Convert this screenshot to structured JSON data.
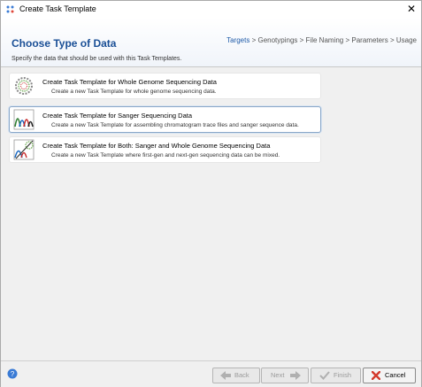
{
  "window": {
    "title": "Create Task Template"
  },
  "breadcrumb": {
    "steps": [
      "Targets",
      "Genotypings",
      "File Naming",
      "Parameters",
      "Usage"
    ],
    "separator": ">"
  },
  "header": {
    "title": "Choose Type of Data",
    "subtitle": "Specify the data that should be used with this Task Templates."
  },
  "options": [
    {
      "title": "Create Task Template for Whole Genome Sequencing Data",
      "description": "Create a new Task Template for whole genome sequencing data.",
      "icon": "genome-circle-icon",
      "selected": false
    },
    {
      "title": "Create Task Template for Sanger Sequencing Data",
      "description": "Create a new Task Template for assembling chromatogram trace files and sanger sequence data.",
      "icon": "chromatogram-icon",
      "selected": true
    },
    {
      "title": "Create Task Template for Both: Sanger and Whole Genome Sequencing Data",
      "description": "Create a new Task Template where first-gen and next-gen sequencing data can be mixed.",
      "icon": "mixed-data-icon",
      "selected": false
    }
  ],
  "footer": {
    "back_label": "Back",
    "next_label": "Next",
    "finish_label": "Finish",
    "cancel_label": "Cancel",
    "help_icon": "help-icon"
  },
  "colors": {
    "accent": "#1a4f96",
    "cancel_icon": "#d33a2c"
  }
}
